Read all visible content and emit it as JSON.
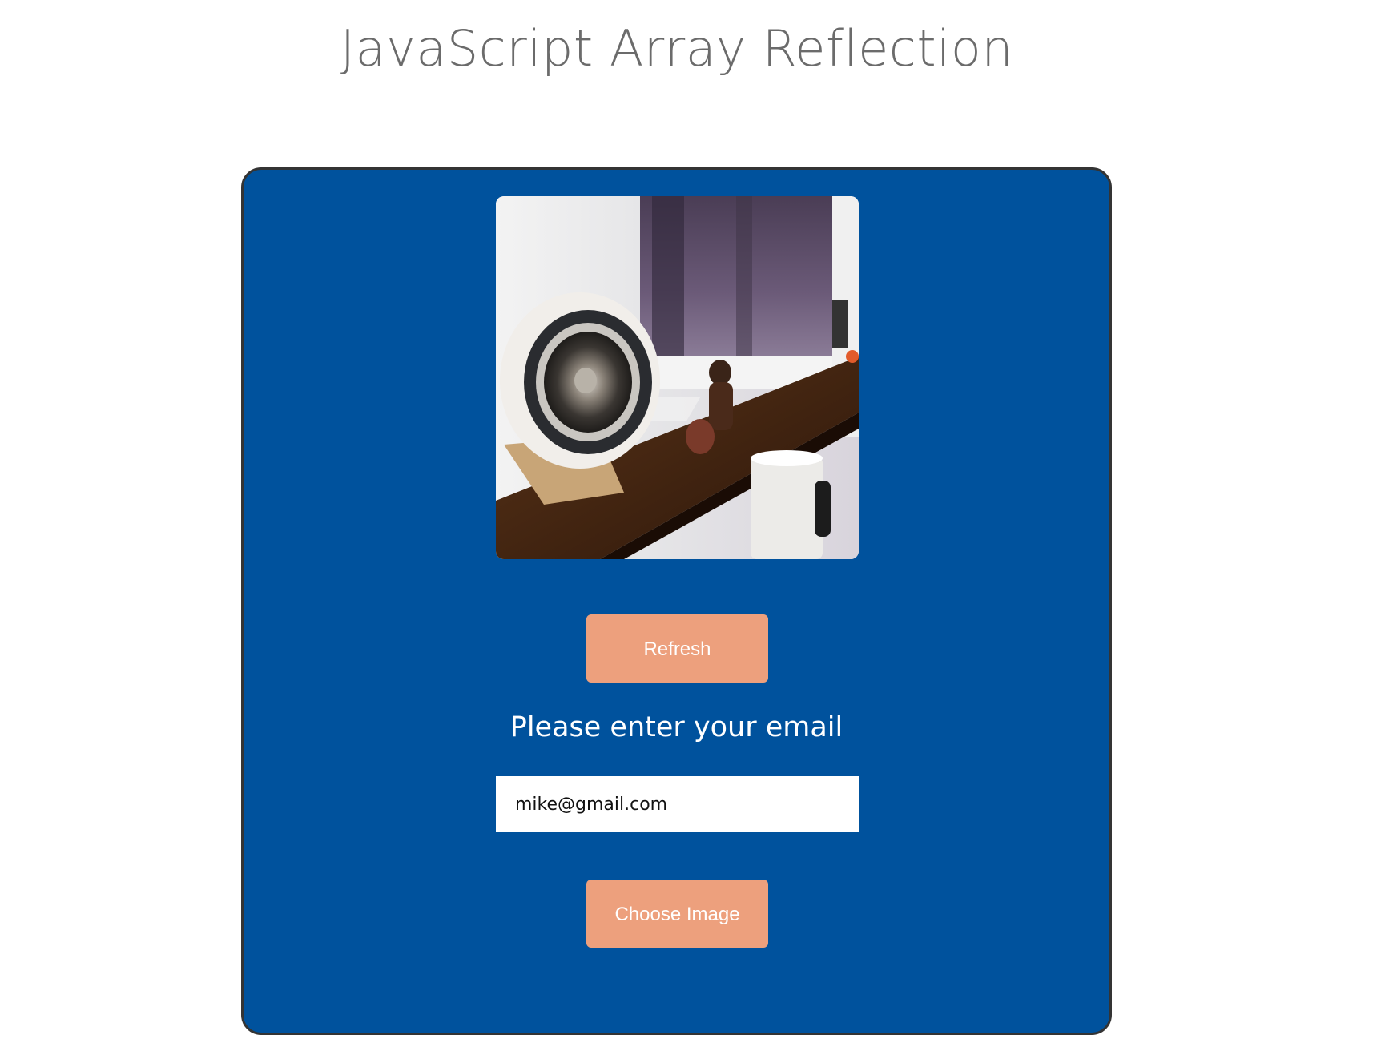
{
  "page": {
    "title": "JavaScript Array Reflection"
  },
  "card": {
    "background": "#00529d",
    "border_color": "#343434",
    "image": {
      "description": "desk with white speaker, figurine, monitor and mug",
      "icon": "photo"
    },
    "refresh_label": "Refresh",
    "prompt": "Please enter your email",
    "email_value": "mike@gmail.com",
    "choose_label": "Choose Image",
    "button_color": "#eda07d"
  }
}
